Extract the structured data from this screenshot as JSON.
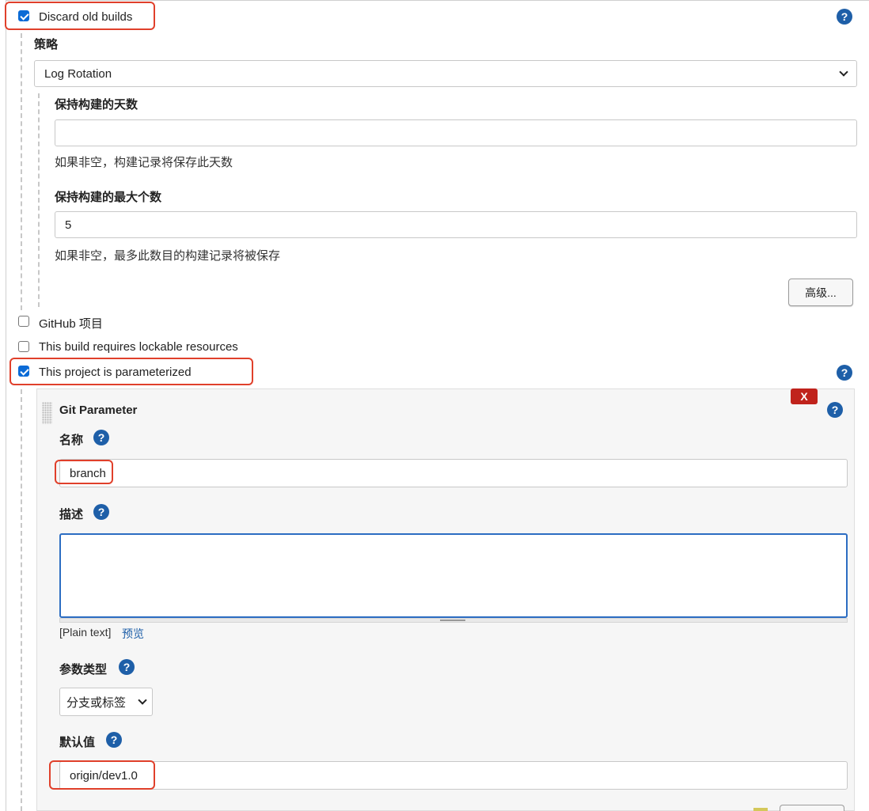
{
  "discard_old_builds": {
    "label": "Discard old builds",
    "checked": true
  },
  "strategy": {
    "label": "策略",
    "selected": "Log Rotation",
    "days_to_keep": {
      "label": "保持构建的天数",
      "value": "",
      "hint": "如果非空，构建记录将保存此天数"
    },
    "max_to_keep": {
      "label": "保持构建的最大个数",
      "value": "5",
      "hint": "如果非空，最多此数目的构建记录将被保存"
    },
    "advanced_button": "高级..."
  },
  "github_project": {
    "label": "GitHub 项目",
    "checked": false
  },
  "lockable_resources": {
    "label": "This build requires lockable resources",
    "checked": false
  },
  "parameterized": {
    "label": "This project is parameterized",
    "checked": true
  },
  "git_parameter": {
    "title": "Git Parameter",
    "delete_label": "X",
    "name": {
      "label": "名称",
      "value": "branch"
    },
    "description": {
      "label": "描述",
      "value": "",
      "format_text": "[Plain text]",
      "preview_link": "预览"
    },
    "param_type": {
      "label": "参数类型",
      "selected": "分支或标签"
    },
    "default_value": {
      "label": "默认值",
      "value": "origin/dev1.0"
    }
  },
  "help_symbol": "?",
  "colors": {
    "accent": "#1e5fa8",
    "highlight": "#e0402b",
    "checkbox": "#0b6bd6",
    "danger": "#c0231c"
  }
}
